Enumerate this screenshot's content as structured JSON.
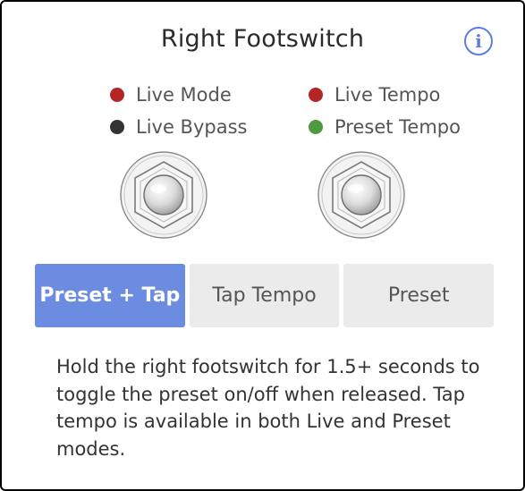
{
  "title": "Right Footswitch",
  "info_icon": "info-icon",
  "legend": {
    "left": [
      {
        "label": "Live Mode",
        "color": "#b52525"
      },
      {
        "label": "Live Bypass",
        "color": "#333333"
      }
    ],
    "right": [
      {
        "label": "Live Tempo",
        "color": "#b52525"
      },
      {
        "label": "Preset Tempo",
        "color": "#4e9a3c"
      }
    ]
  },
  "footswitches": [
    "footswitch-icon",
    "footswitch-icon"
  ],
  "modes": {
    "selected": "Preset + Tap",
    "options": [
      "Preset + Tap",
      "Tap Tempo",
      "Preset"
    ]
  },
  "description": "Hold the right footswitch for 1.5+ seconds to toggle the preset on/off when released. Tap tempo is available in both Live and Preset modes.",
  "colors": {
    "accent": "#6b8ce0",
    "info": "#5b7ee0",
    "segment_bg": "#ebebeb"
  }
}
